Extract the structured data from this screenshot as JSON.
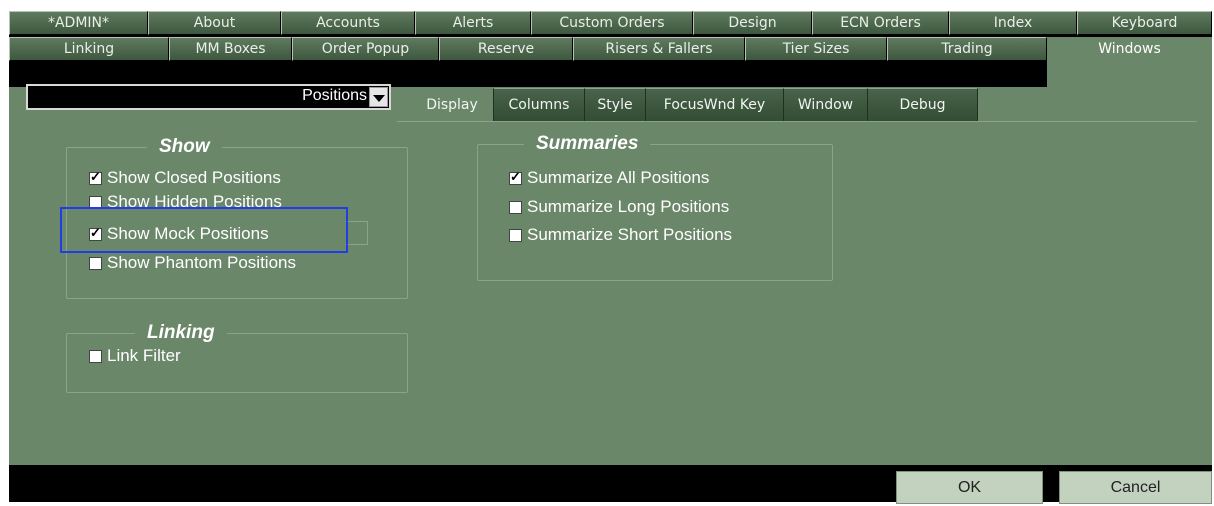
{
  "tabs_row1": [
    "*ADMIN*",
    "About",
    "Accounts",
    "Alerts",
    "Custom Orders",
    "Design",
    "ECN Orders",
    "Index",
    "Keyboard"
  ],
  "tabs_row2": [
    "Linking",
    "MM Boxes",
    "Order Popup",
    "Reserve",
    "Risers & Fallers",
    "Tier Sizes",
    "Trading",
    "Windows"
  ],
  "active_tab": "Windows",
  "window_selector": {
    "value": "Positions"
  },
  "subtabs": [
    "Display",
    "Columns",
    "Style",
    "FocusWnd Key",
    "Window",
    "Debug"
  ],
  "active_subtab": "Display",
  "show_group": {
    "title": "Show",
    "items": [
      {
        "label": "Show Closed Positions",
        "checked": true
      },
      {
        "label": "Show Hidden Positions",
        "checked": false
      },
      {
        "label": "Show Mock Positions",
        "checked": true
      },
      {
        "label": "Show Phantom Positions",
        "checked": false
      }
    ]
  },
  "linking_group": {
    "title": "Linking",
    "items": [
      {
        "label": "Link Filter",
        "checked": false
      }
    ]
  },
  "summaries_group": {
    "title": "Summaries",
    "items": [
      {
        "label": "Summarize All Positions",
        "checked": true
      },
      {
        "label": "Summarize Long Positions",
        "checked": false
      },
      {
        "label": "Summarize Short Positions",
        "checked": false
      }
    ]
  },
  "buttons": {
    "ok": "OK",
    "cancel": "Cancel"
  },
  "colors": {
    "panel": "#6b8769",
    "highlight": "#1f3ee6"
  }
}
